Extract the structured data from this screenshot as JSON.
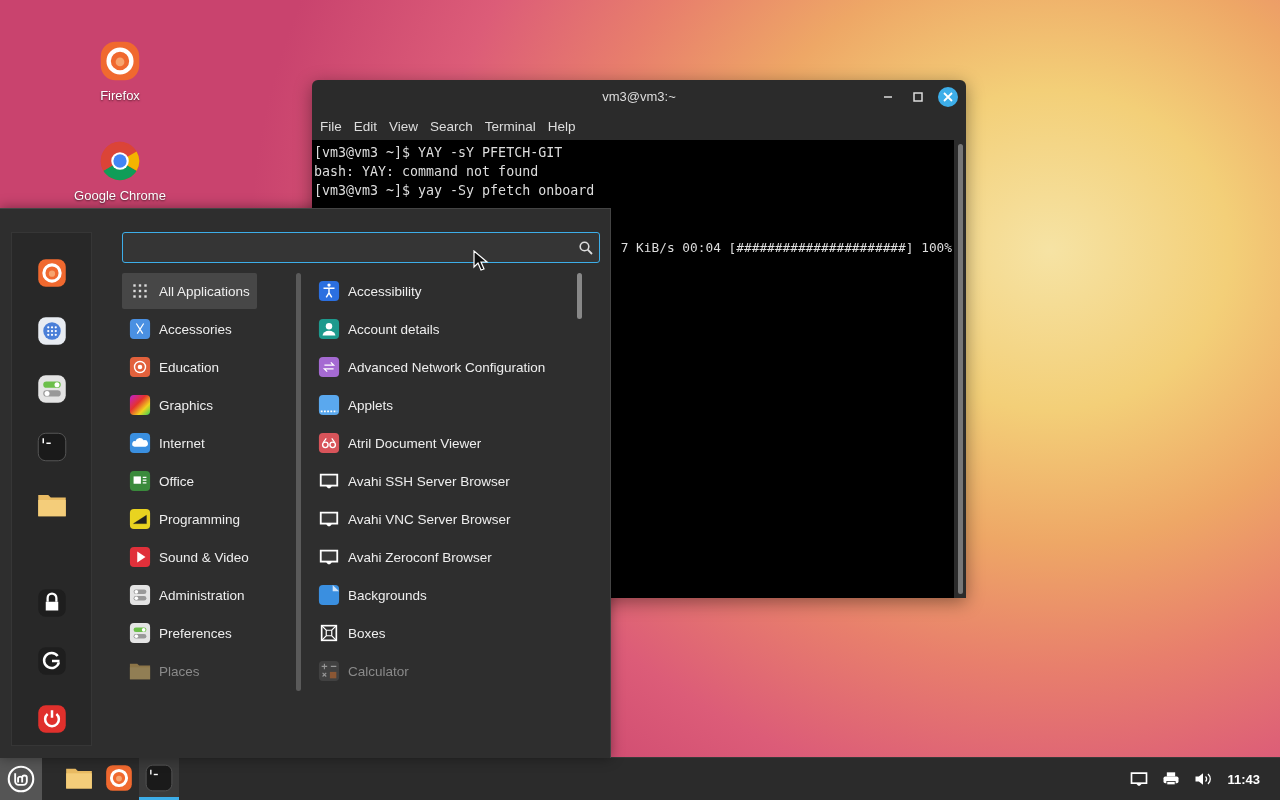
{
  "desktop_icons": [
    {
      "label": "Firefox",
      "kind": "firefox"
    },
    {
      "label": "Google Chrome",
      "kind": "chrome"
    }
  ],
  "terminal": {
    "title": "vm3@vm3:~",
    "menu": [
      "File",
      "Edit",
      "View",
      "Search",
      "Terminal",
      "Help"
    ],
    "lines": [
      {
        "kind": "text",
        "text": "[vm3@vm3 ~]$ YAY -sY PFETCH-GIT"
      },
      {
        "kind": "text",
        "text": "bash: YAY: command not found"
      },
      {
        "kind": "text",
        "text": "[vm3@vm3 ~]$ yay -Sy pfetch onboard"
      },
      {
        "kind": "progress",
        "text": "7 KiB/s 00:04 [######################] 100%"
      }
    ]
  },
  "menu": {
    "favorites": [
      {
        "kind": "firefox"
      },
      {
        "kind": "apps"
      },
      {
        "kind": "settings"
      },
      {
        "kind": "terminal"
      },
      {
        "kind": "folder"
      }
    ],
    "session": [
      {
        "kind": "lock"
      },
      {
        "kind": "logout"
      },
      {
        "kind": "power"
      }
    ],
    "categories": [
      {
        "label": "All Applications",
        "kind": "all",
        "selected": true,
        "faded": false
      },
      {
        "label": "Accessories",
        "kind": "accessories",
        "selected": false,
        "faded": false
      },
      {
        "label": "Education",
        "kind": "education",
        "selected": false,
        "faded": false
      },
      {
        "label": "Graphics",
        "kind": "graphics",
        "selected": false,
        "faded": false
      },
      {
        "label": "Internet",
        "kind": "internet",
        "selected": false,
        "faded": false
      },
      {
        "label": "Office",
        "kind": "office",
        "selected": false,
        "faded": false
      },
      {
        "label": "Programming",
        "kind": "programming",
        "selected": false,
        "faded": false
      },
      {
        "label": "Sound & Video",
        "kind": "media",
        "selected": false,
        "faded": false
      },
      {
        "label": "Administration",
        "kind": "admin",
        "selected": false,
        "faded": false
      },
      {
        "label": "Preferences",
        "kind": "prefs",
        "selected": false,
        "faded": false
      },
      {
        "label": "Places",
        "kind": "folder",
        "selected": false,
        "faded": true
      }
    ],
    "apps": [
      {
        "label": "Accessibility",
        "kind": "accessibility",
        "faded": false
      },
      {
        "label": "Account details",
        "kind": "account",
        "faded": false
      },
      {
        "label": "Advanced Network Configuration",
        "kind": "network",
        "faded": false
      },
      {
        "label": "Applets",
        "kind": "applets",
        "faded": false
      },
      {
        "label": "Atril Document Viewer",
        "kind": "atril",
        "faded": false
      },
      {
        "label": "Avahi SSH Server Browser",
        "kind": "monitor",
        "faded": false
      },
      {
        "label": "Avahi VNC Server Browser",
        "kind": "monitor",
        "faded": false
      },
      {
        "label": "Avahi Zeroconf Browser",
        "kind": "monitor",
        "faded": false
      },
      {
        "label": "Backgrounds",
        "kind": "backgrounds",
        "faded": false
      },
      {
        "label": "Boxes",
        "kind": "boxes",
        "faded": false
      },
      {
        "label": "Calculator",
        "kind": "calculator",
        "faded": true
      }
    ]
  },
  "taskbar": {
    "apps": [
      {
        "kind": "folder",
        "active": false
      },
      {
        "kind": "firefox",
        "active": false
      },
      {
        "kind": "terminal",
        "active": true
      }
    ],
    "tray": [
      {
        "kind": "network"
      },
      {
        "kind": "printer"
      },
      {
        "kind": "volume"
      }
    ],
    "clock": "11:43"
  }
}
